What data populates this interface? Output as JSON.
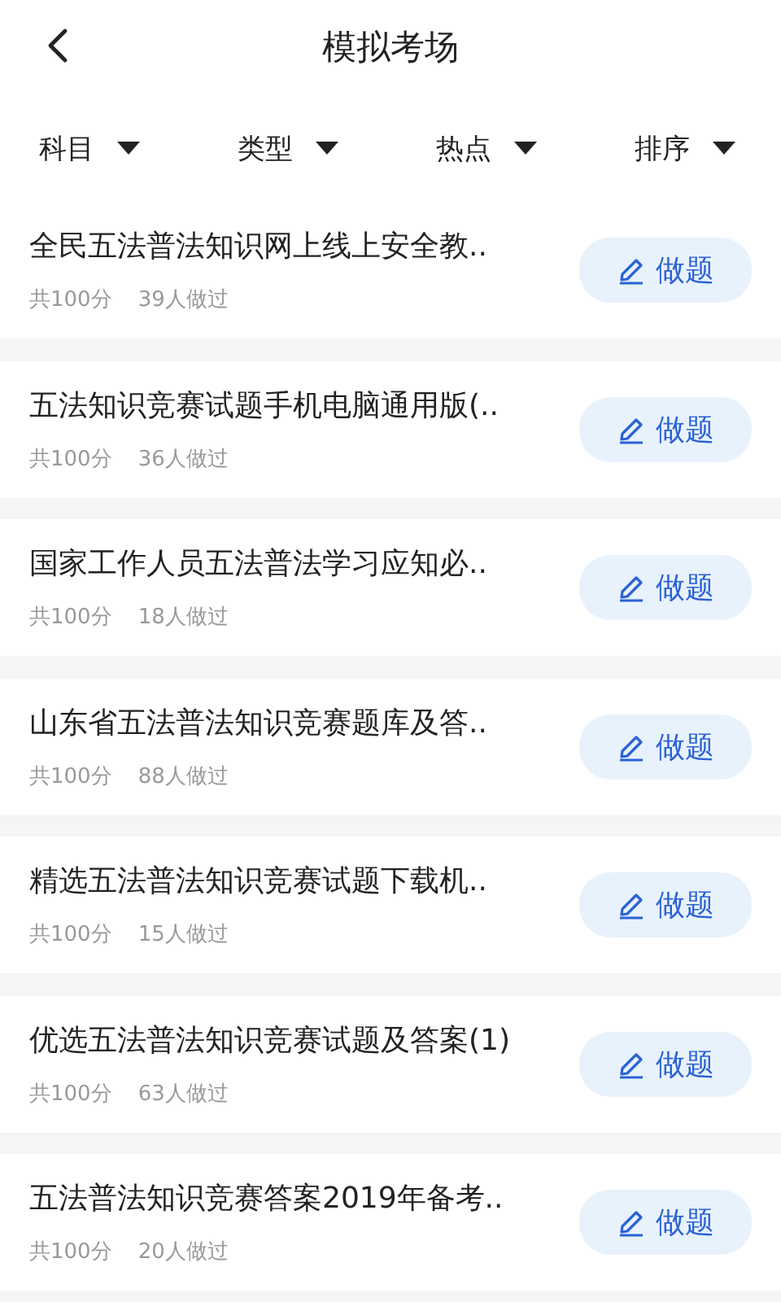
{
  "header": {
    "title": "模拟考场"
  },
  "filters": [
    {
      "label": "科目"
    },
    {
      "label": "类型"
    },
    {
      "label": "热点"
    },
    {
      "label": "排序"
    }
  ],
  "exams": [
    {
      "title": "全民五法普法知识网上线上安全教..",
      "score": "共100分",
      "taken": "39人做过",
      "action": "做题"
    },
    {
      "title": "五法知识竞赛试题手机电脑通用版(..",
      "score": "共100分",
      "taken": "36人做过",
      "action": "做题"
    },
    {
      "title": "国家工作人员五法普法学习应知必..",
      "score": "共100分",
      "taken": "18人做过",
      "action": "做题"
    },
    {
      "title": "山东省五法普法知识竞赛题库及答..",
      "score": "共100分",
      "taken": "88人做过",
      "action": "做题"
    },
    {
      "title": "精选五法普法知识竞赛试题下载机..",
      "score": "共100分",
      "taken": "15人做过",
      "action": "做题"
    },
    {
      "title": "优选五法普法知识竞赛试题及答案(1)",
      "score": "共100分",
      "taken": "63人做过",
      "action": "做题"
    },
    {
      "title": "五法普法知识竞赛答案2019年备考..",
      "score": "共100分",
      "taken": "20人做过",
      "action": "做题"
    }
  ]
}
